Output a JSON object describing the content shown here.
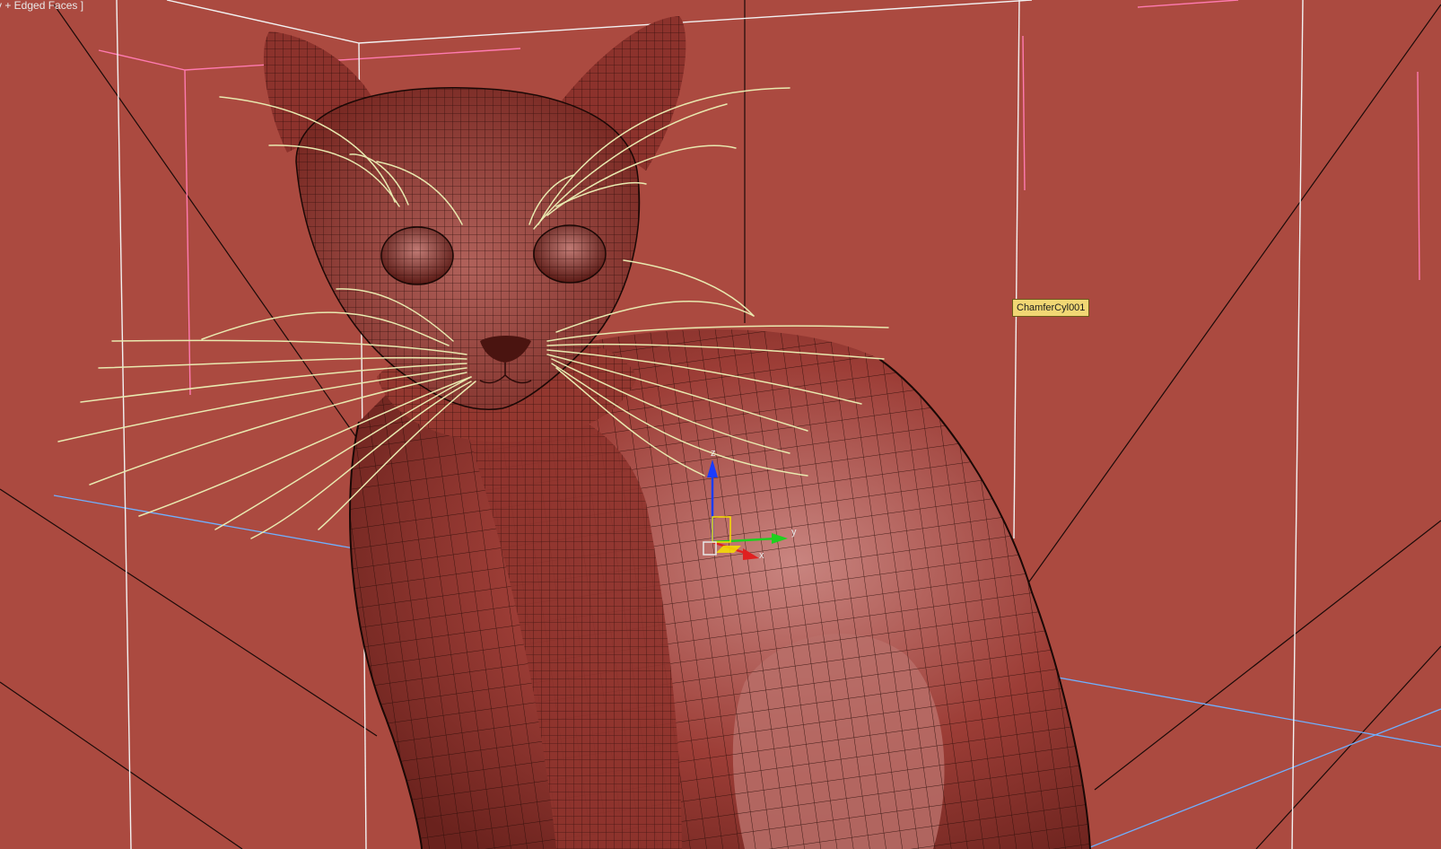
{
  "viewport": {
    "label": "y + Edged Faces ]",
    "background_color": "#ab4a40",
    "shading_mode": "Edged Faces"
  },
  "tooltip": {
    "object_name": "ChamferCyl001",
    "background_color": "#f1d774"
  },
  "gizmo": {
    "axes": [
      {
        "name": "z",
        "color": "#1a3cff"
      },
      {
        "name": "y",
        "color": "#1fd01f"
      },
      {
        "name": "x",
        "color": "#e02020"
      }
    ]
  },
  "scene": {
    "subject": "cat-model",
    "mesh_color": "#9a3b34",
    "wire_color": "#2a0c08",
    "whisker_color": "#e9eab0",
    "bounding_box_color": "#f2f2f2",
    "selection_bracket_color": "#ff7ab0",
    "guide_line_color": "#6fb0ff"
  }
}
